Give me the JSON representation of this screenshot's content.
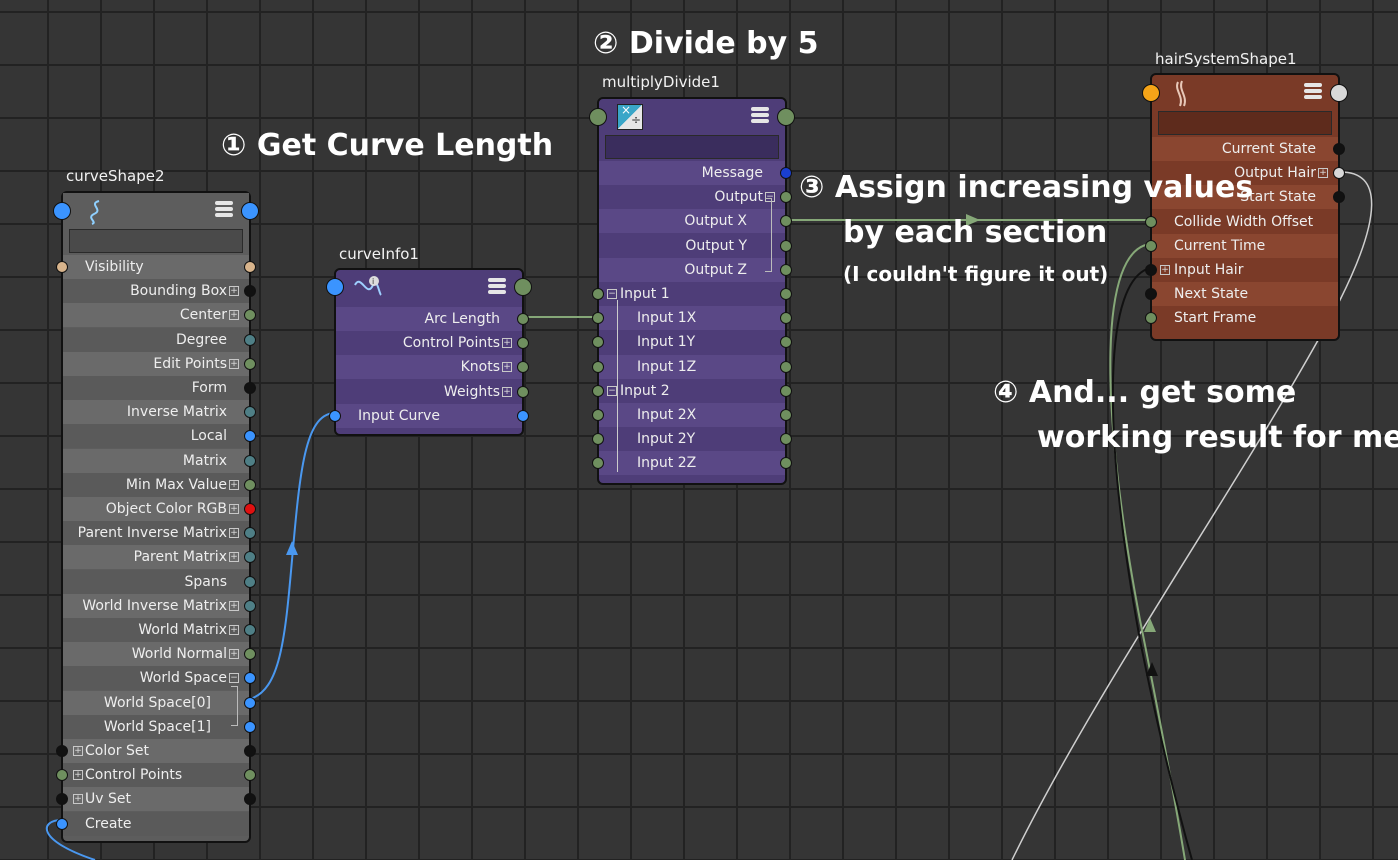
{
  "annotations": {
    "step1": "① Get Curve Length",
    "step2": "② Divide by 5",
    "step3_line1": "③ Assign increasing values",
    "step3_line2": "by each section",
    "step3_line3": "(I couldn't figure it out)",
    "step4_line1": "④ And... get some",
    "step4_line2": "working result for me?"
  },
  "nodes": {
    "curveShape": {
      "title": "curveShape2",
      "rows": [
        "Visibility",
        "Bounding Box",
        "Center",
        "Degree",
        "Edit Points",
        "Form",
        "Inverse Matrix",
        "Local",
        "Matrix",
        "Min Max Value",
        "Object Color RGB",
        "Parent Inverse Matrix",
        "Parent Matrix",
        "Spans",
        "World Inverse Matrix",
        "World Matrix",
        "World Normal",
        "World Space",
        "World Space[0]",
        "World Space[1]",
        "Color Set",
        "Control Points",
        "Uv Set",
        "Create"
      ]
    },
    "curveInfo": {
      "title": "curveInfo1",
      "rows": [
        "Arc Length",
        "Control Points",
        "Knots",
        "Weights",
        "Input Curve"
      ]
    },
    "multiplyDivide": {
      "title": "multiplyDivide1",
      "rows": [
        "Message",
        "Output",
        "Output X",
        "Output Y",
        "Output Z",
        "Input 1",
        "Input 1X",
        "Input 1Y",
        "Input 1Z",
        "Input 2",
        "Input 2X",
        "Input 2Y",
        "Input 2Z"
      ]
    },
    "hairSystem": {
      "title": "hairSystemShape1",
      "rows": [
        "Current State",
        "Output Hair",
        "Start State",
        "Collide Width Offset",
        "Current Time",
        "Input Hair",
        "Next State",
        "Start Frame"
      ]
    }
  },
  "colors": {
    "canvas": "#353535",
    "grid": "#222222",
    "curveShape_body": "#5d5d5d",
    "curveInfo_body": "#4e3d78",
    "multiplyDivide_body": "#4e3d78",
    "hairSystem_body": "#7a3a27",
    "port_blue": "#3b94ff",
    "port_green": "#6f8f5f",
    "port_teal": "#4f7f86",
    "port_red": "#e01010",
    "wire_green": "#86a878",
    "wire_blue": "#4a98f0"
  }
}
